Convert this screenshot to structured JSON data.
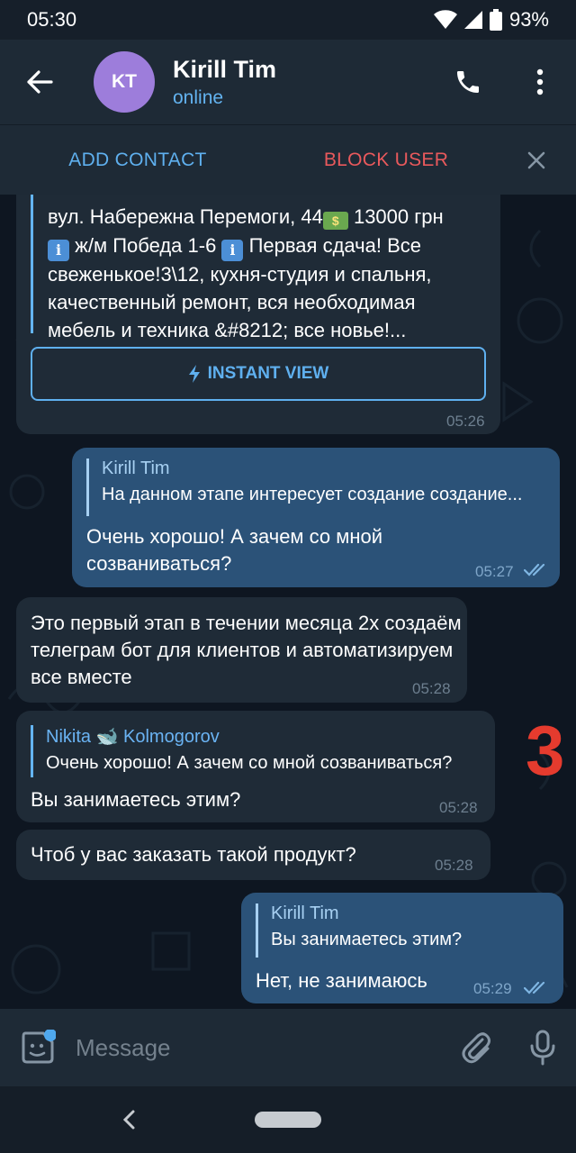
{
  "status_bar": {
    "time": "05:30",
    "battery": "93%"
  },
  "header": {
    "avatar_initials": "KT",
    "avatar_color": "#9d7ddb",
    "name": "Kirill Tim",
    "status": "online"
  },
  "action_bar": {
    "add_contact": "ADD CONTACT",
    "block_user": "BLOCK USER"
  },
  "messages": {
    "m0": {
      "line1": "вул. Набережна Перемоги, 44",
      "line1b": "13000 грн",
      "line2": "ж/м Победа 1-6",
      "line2b": "Первая сдача! Все",
      "line3": "свеженькое!3\\12, кухня-студия и спальня,",
      "line4": "качественный ремонт, вся необходимая",
      "line5": "мебель и техника &#8212; все новье!...",
      "instant_view": "INSTANT VIEW",
      "time": "05:26"
    },
    "m1": {
      "reply_name": "Kirill Tim",
      "reply_text": "На данном этапе интересует создание создание...",
      "text": "Очень хорошо! А зачем со мной созваниваться?",
      "time": "05:27"
    },
    "m2": {
      "text": "Это первый этап в течении месяца 2х создаём телеграм бот для клиентов и автоматизируем все вместе",
      "time": "05:28"
    },
    "m3": {
      "reply_name": "Nikita 🐋 Kolmogorov",
      "reply_text": "Очень хорошо! А зачем со мной созваниваться?",
      "text": "Вы занимаетесь этим?",
      "time": "05:28"
    },
    "m4": {
      "text": "Чтоб у вас заказать такой продукт?",
      "time": "05:28"
    },
    "m5": {
      "reply_name": "Kirill Tim",
      "reply_text": "Вы занимаетесь этим?",
      "text": "Нет, не занимаюсь",
      "time": "05:29"
    }
  },
  "annotation_number": "3",
  "composer": {
    "placeholder": "Message"
  }
}
